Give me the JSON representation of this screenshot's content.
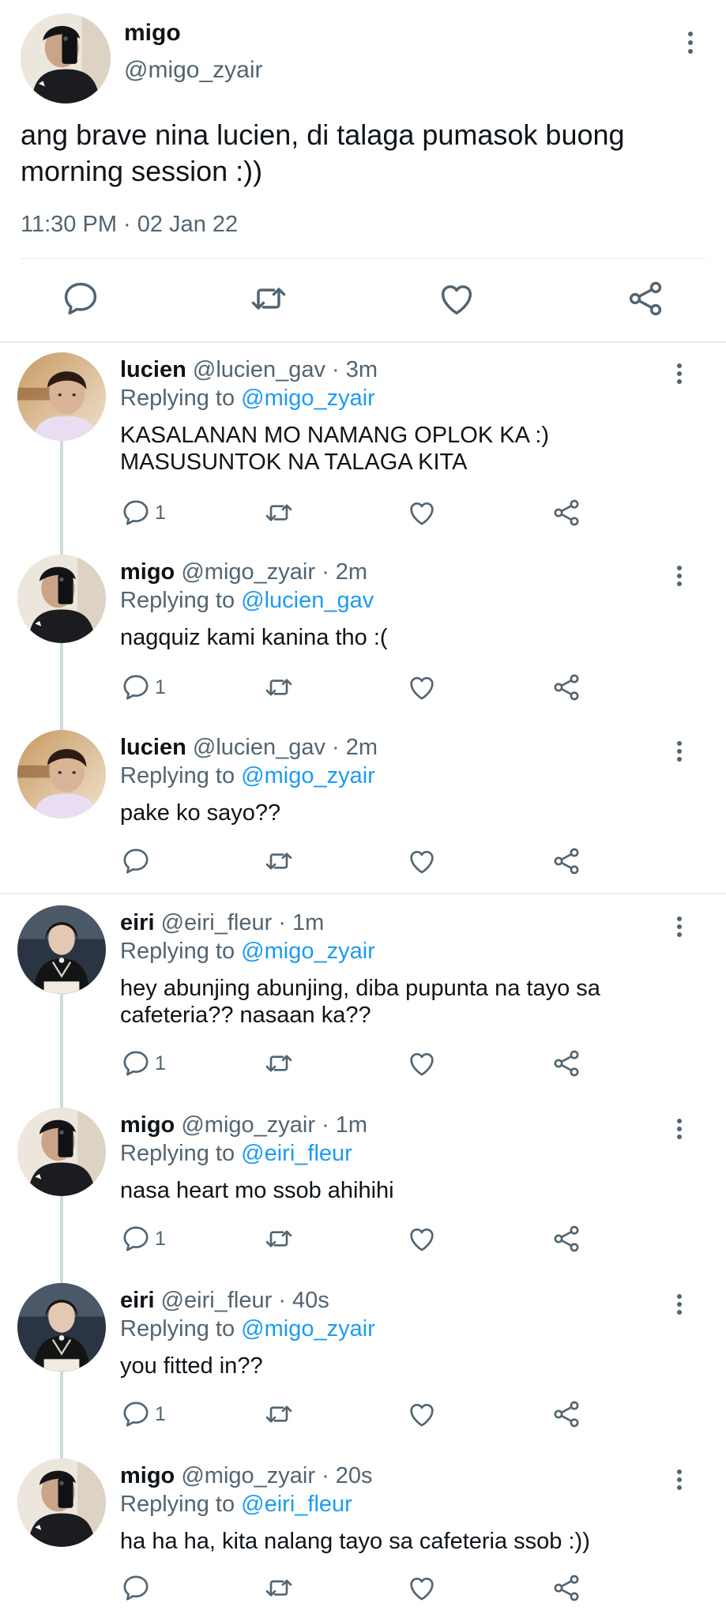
{
  "main_tweet": {
    "name": "migo",
    "handle": "@migo_zyair",
    "text": "ang brave nina lucien, di talaga pumasok buong morning session :))",
    "timestamp": "11:30 PM · 02 Jan 22",
    "icons": [
      "reply-icon",
      "retweet-icon",
      "like-icon",
      "share-icon",
      "more-icon"
    ]
  },
  "replies": [
    {
      "name": "lucien",
      "handle": "@lucien_gav",
      "dot": "·",
      "time": "3m",
      "replying_label": "Replying to",
      "replying_to": "@migo_zyair",
      "text": "KASALANAN MO NAMANG OPLOK KA :) MASUSUNTOK NA TALAGA KITA",
      "reply_count": "1",
      "avatar": "lucien"
    },
    {
      "name": "migo",
      "handle": "@migo_zyair",
      "dot": "·",
      "time": "2m",
      "replying_label": "Replying to",
      "replying_to": "@lucien_gav",
      "text": "nagquiz kami kanina tho :(",
      "reply_count": "1",
      "avatar": "migo"
    },
    {
      "name": "lucien",
      "handle": "@lucien_gav",
      "dot": "·",
      "time": "2m",
      "replying_label": "Replying to",
      "replying_to": "@migo_zyair",
      "text": "pake ko sayo??",
      "reply_count": "",
      "avatar": "lucien"
    },
    {
      "name": "eiri",
      "handle": "@eiri_fleur",
      "dot": "·",
      "time": "1m",
      "replying_label": "Replying to",
      "replying_to": "@migo_zyair",
      "text": "hey abunjing abunjing, diba pupunta na tayo sa cafeteria?? nasaan ka??",
      "reply_count": "1",
      "avatar": "eiri"
    },
    {
      "name": "migo",
      "handle": "@migo_zyair",
      "dot": "·",
      "time": "1m",
      "replying_label": "Replying to",
      "replying_to": "@eiri_fleur",
      "text": "nasa heart mo ssob ahihihi",
      "reply_count": "1",
      "avatar": "migo"
    },
    {
      "name": "eiri",
      "handle": "@eiri_fleur",
      "dot": "·",
      "time": "40s",
      "replying_label": "Replying to",
      "replying_to": "@migo_zyair",
      "text": "you fitted in??",
      "reply_count": "1",
      "avatar": "eiri"
    },
    {
      "name": "migo",
      "handle": "@migo_zyair",
      "dot": "·",
      "time": "20s",
      "replying_label": "Replying to",
      "replying_to": "@eiri_fleur",
      "text": "ha ha ha, kita nalang tayo sa cafeteria ssob :))",
      "reply_count": "",
      "avatar": "migo"
    }
  ],
  "colors": {
    "text": "#0f1419",
    "secondary": "#536471",
    "accent": "#1d9bf0",
    "divider": "#e6ecf0"
  }
}
